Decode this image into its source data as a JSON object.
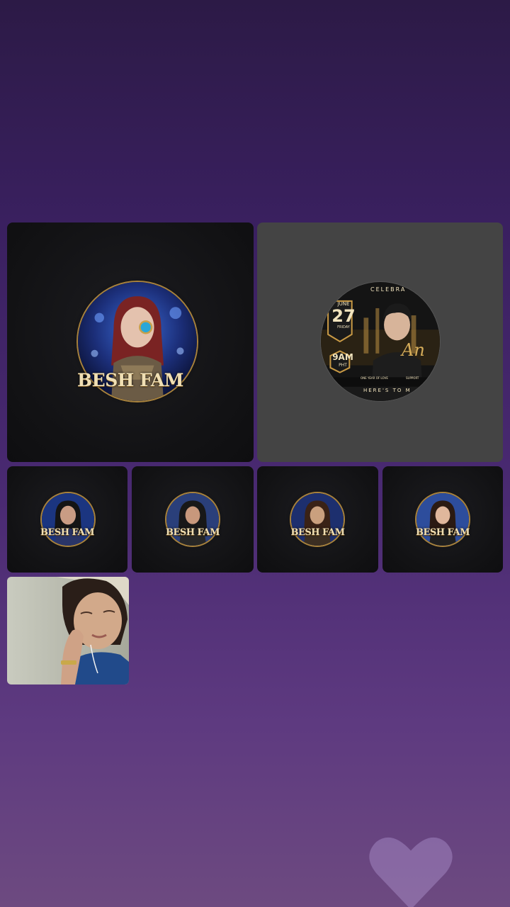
{
  "participants": [
    {
      "tile": "main-left",
      "badge_text": "BESH FAM"
    },
    {
      "tile": "main-right",
      "event": {
        "banner_top": "CELEBRA",
        "month": "JUNE",
        "day": "27",
        "weekday": "FRIDAY",
        "time": "9AM",
        "tz": "PHT",
        "script_name": "An",
        "bottom": "HERE'S TO M",
        "bar_left": "ONE YEAR OF LOVE",
        "bar_right": "SUPPORT"
      }
    },
    {
      "tile": "small-1",
      "badge_text": "BESH FAM"
    },
    {
      "tile": "small-2",
      "badge_text": "BESH FAM"
    },
    {
      "tile": "small-3",
      "badge_text": "BESH FAM"
    },
    {
      "tile": "small-4",
      "badge_text": "BESH FAM"
    },
    {
      "tile": "camera-feed"
    }
  ],
  "colors": {
    "background_top": "#2c1a46",
    "background_bottom": "#6d4a80",
    "tile_dark": "#121214",
    "tile_grey": "#444444",
    "gold": "#a8823c"
  },
  "icons": [
    "heart-icon"
  ]
}
